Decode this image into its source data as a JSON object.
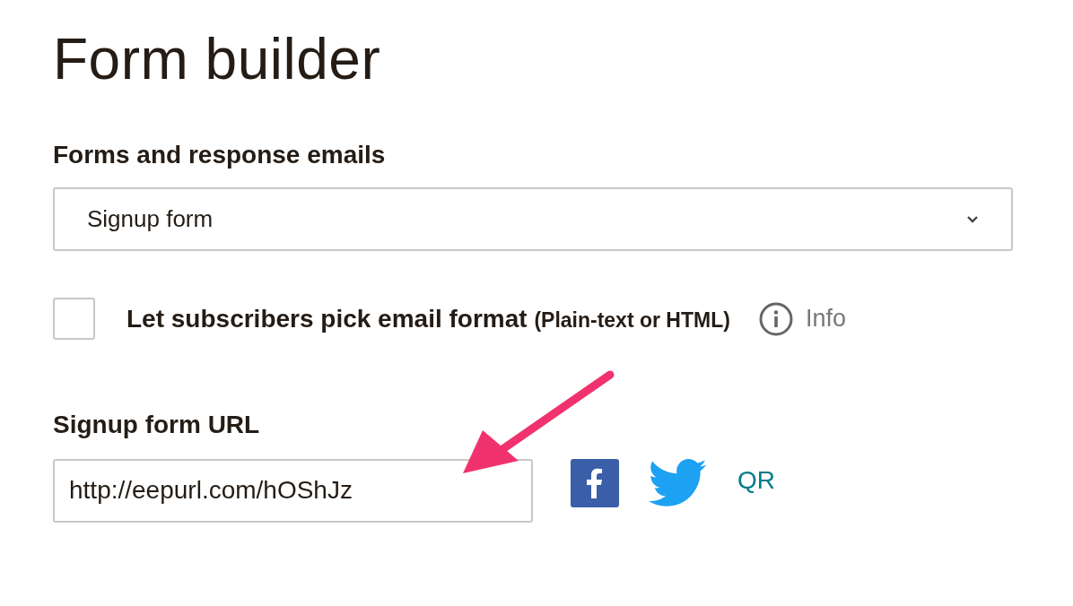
{
  "page": {
    "title": "Form builder"
  },
  "forms_section": {
    "label": "Forms and response emails",
    "select_value": "Signup form"
  },
  "format_option": {
    "checked": false,
    "label": "Let subscribers pick email format",
    "note": "(Plain-text or HTML)",
    "info_label": "Info"
  },
  "url_section": {
    "label": "Signup form URL",
    "value": "http://eepurl.com/hOShJz",
    "qr_label": "QR"
  }
}
